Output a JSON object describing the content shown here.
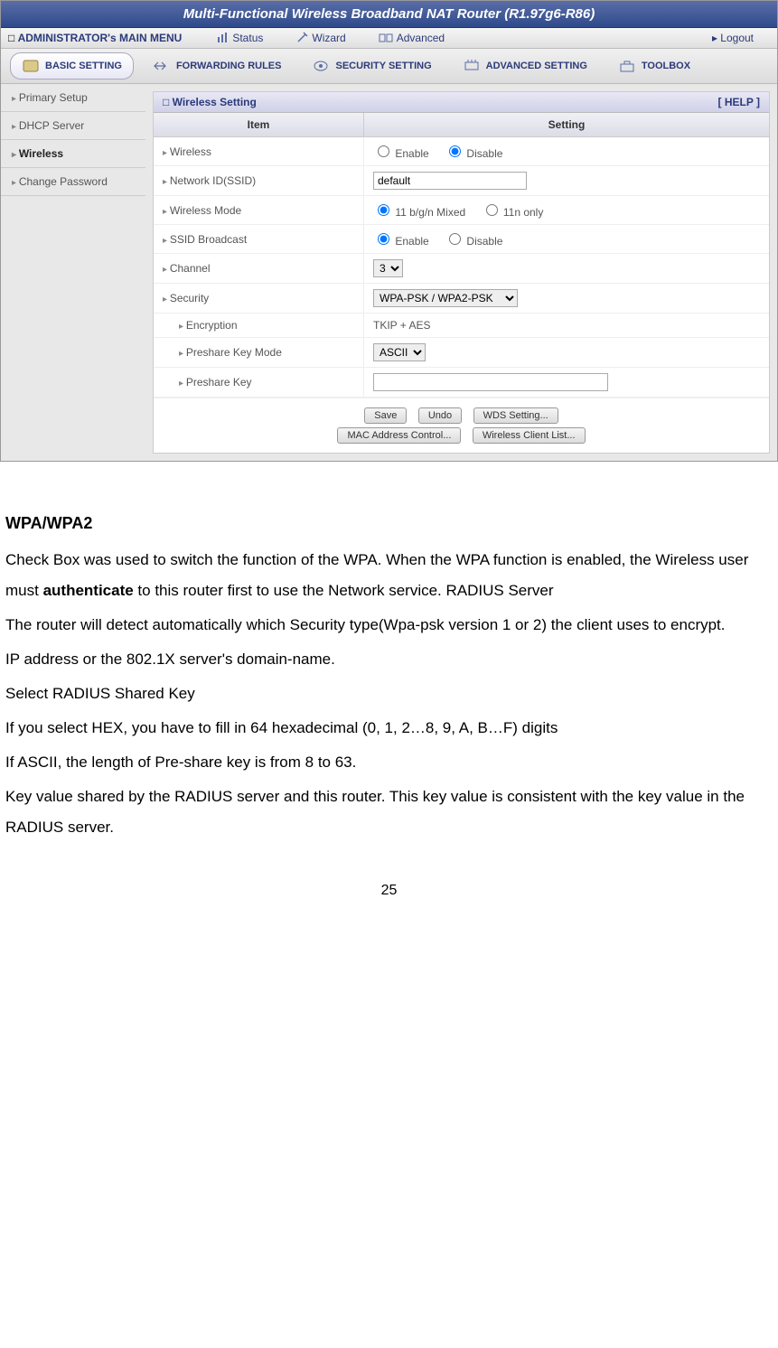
{
  "router": {
    "title": "Multi-Functional Wireless Broadband NAT Router (R1.97g6-R86)",
    "mainMenu": {
      "label": "ADMINISTRATOR's MAIN MENU",
      "items": [
        "Status",
        "Wizard",
        "Advanced"
      ],
      "logout": "Logout"
    },
    "subMenu": {
      "items": [
        "BASIC SETTING",
        "FORWARDING RULES",
        "SECURITY SETTING",
        "ADVANCED SETTING",
        "TOOLBOX"
      ]
    },
    "sidebar": {
      "items": [
        "Primary Setup",
        "DHCP Server",
        "Wireless",
        "Change Password"
      ],
      "activeIndex": 2
    },
    "panel": {
      "title": "Wireless Setting",
      "help": "[ HELP ]",
      "columns": {
        "item": "Item",
        "setting": "Setting"
      },
      "rows": {
        "wireless": {
          "label": "Wireless",
          "enable": "Enable",
          "disable": "Disable"
        },
        "ssid": {
          "label": "Network ID(SSID)",
          "value": "default"
        },
        "mode": {
          "label": "Wireless Mode",
          "opt1": "11 b/g/n Mixed",
          "opt2": "11n only"
        },
        "broadcast": {
          "label": "SSID Broadcast",
          "enable": "Enable",
          "disable": "Disable"
        },
        "channel": {
          "label": "Channel",
          "value": "3"
        },
        "security": {
          "label": "Security",
          "value": "WPA-PSK / WPA2-PSK"
        },
        "encryption": {
          "label": "Encryption",
          "value": "TKIP + AES"
        },
        "preshareMode": {
          "label": "Preshare Key Mode",
          "value": "ASCII"
        },
        "preshareKey": {
          "label": "Preshare Key",
          "value": ""
        }
      },
      "buttons": {
        "save": "Save",
        "undo": "Undo",
        "wds": "WDS Setting...",
        "mac": "MAC Address Control...",
        "clients": "Wireless Client List..."
      }
    }
  },
  "doc": {
    "h1": "WPA/WPA2",
    "p1a": "Check Box was used to switch the function of the WPA. When the WPA function is enabled, the Wireless user must ",
    "p1b": "authenticate",
    "p1c": " to this router first to use the Network service. RADIUS Server",
    "p2": "The router will detect automatically    which Security type(Wpa-psk version 1 or 2) the client uses to encrypt.",
    "p3": "IP address or the 802.1X server's domain-name.",
    "p4": "Select RADIUS Shared Key",
    "p5": "If you select HEX, you have to fill in 64 hexadecimal (0, 1, 2…8, 9, A, B…F) digits",
    "p6": "If ASCII, the length of Pre-share key is from 8 to 63.",
    "p7": "Key value shared by the RADIUS server and this router. This key value is consistent with the key value in the RADIUS server.",
    "pageNumber": "25"
  }
}
